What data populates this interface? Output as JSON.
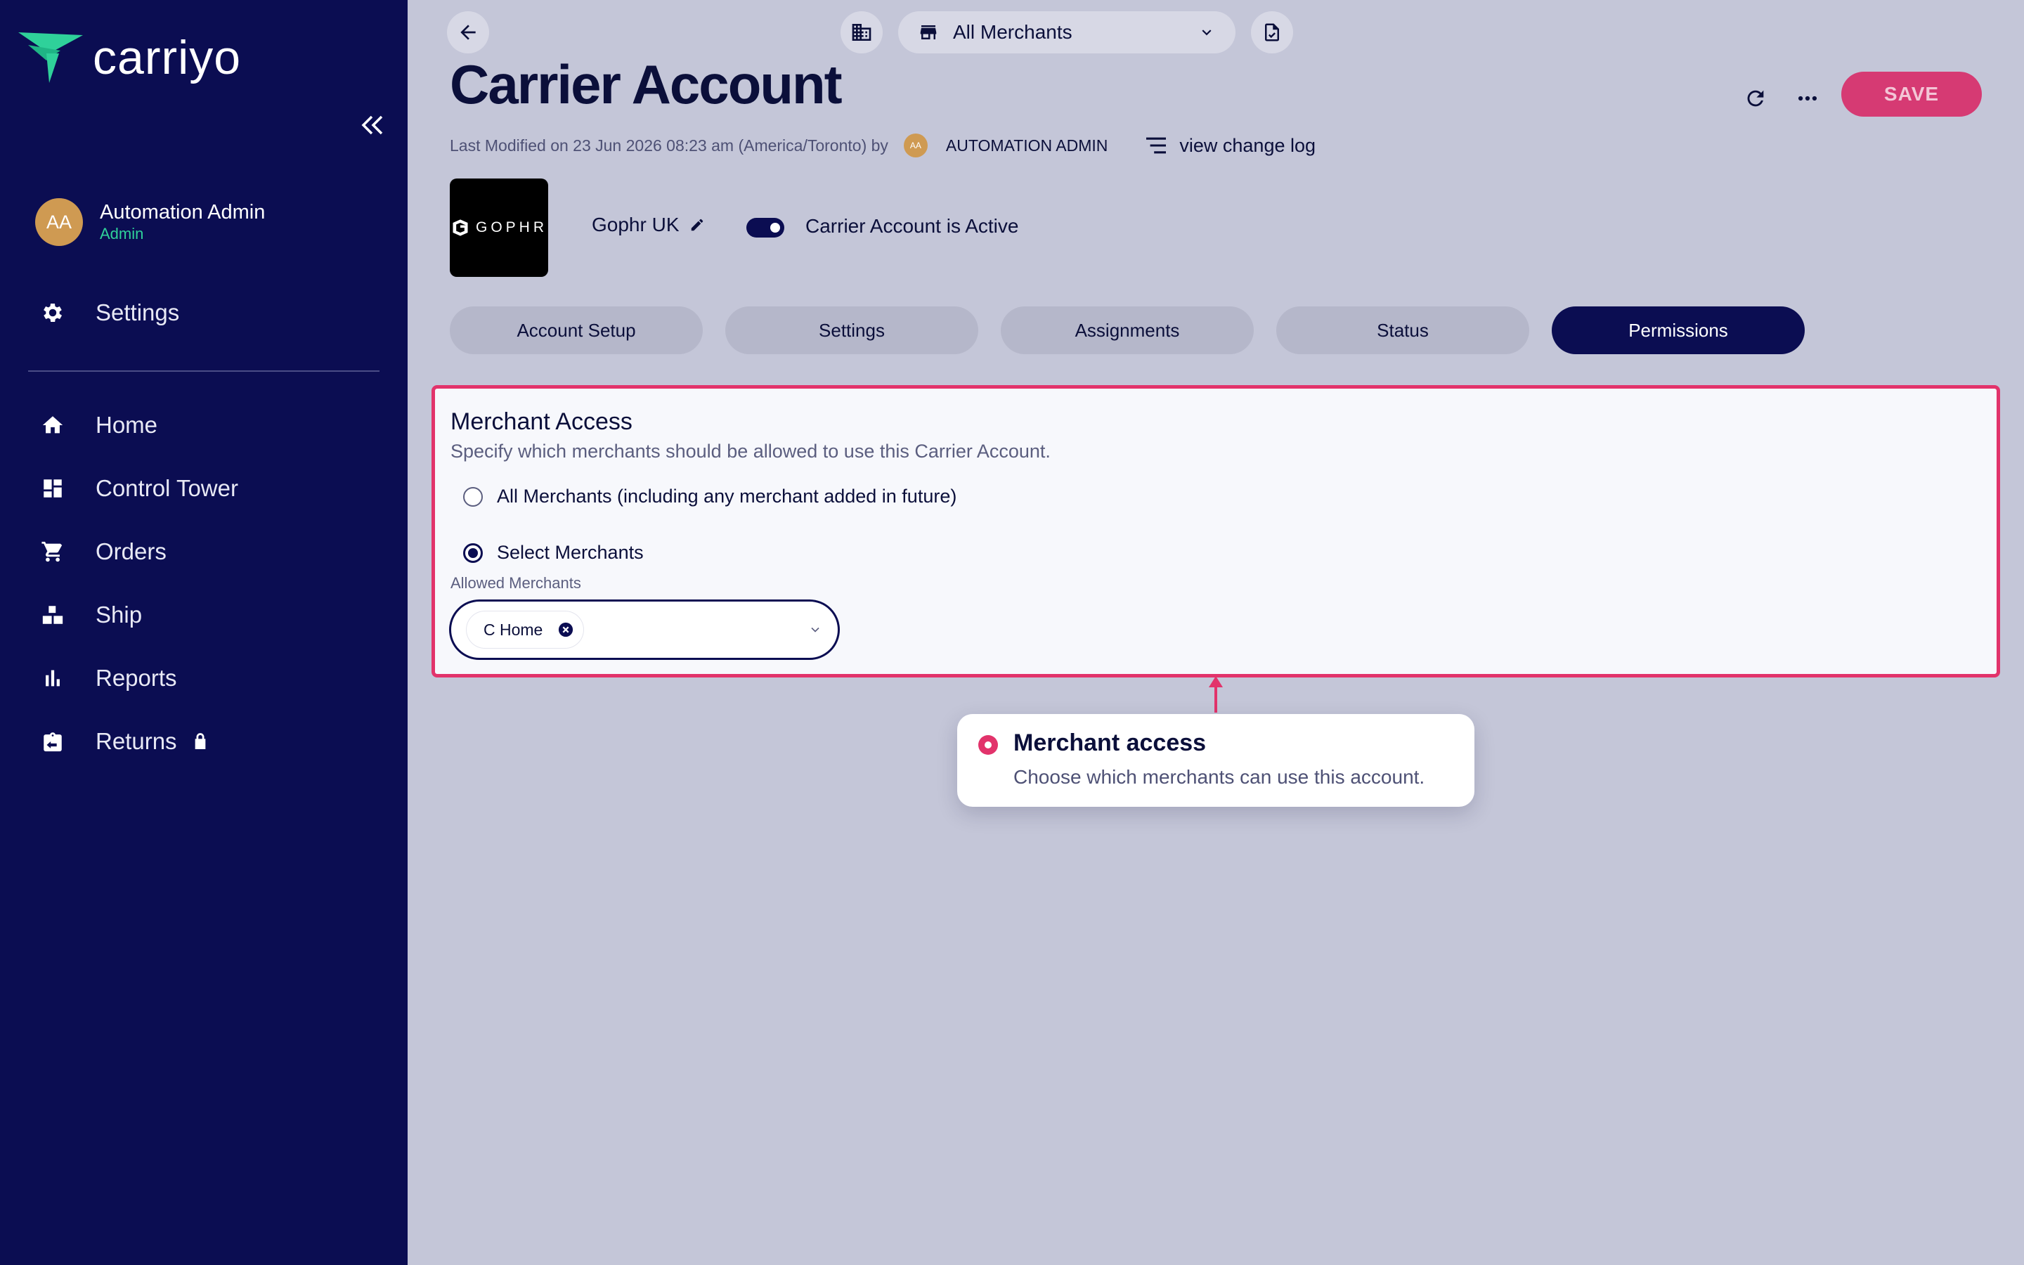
{
  "brand": {
    "name": "carriyo",
    "accent": "#2fd19a",
    "sidebar_bg": "#0b0d52",
    "highlight": "#e2336b"
  },
  "user": {
    "initials": "AA",
    "name": "Automation Admin",
    "role": "Admin"
  },
  "sidebar": {
    "settings_label": "Settings",
    "items": [
      {
        "label": "Home",
        "icon": "home-icon"
      },
      {
        "label": "Control Tower",
        "icon": "dashboard-icon"
      },
      {
        "label": "Orders",
        "icon": "cart-icon"
      },
      {
        "label": "Ship",
        "icon": "ship-icon"
      },
      {
        "label": "Reports",
        "icon": "bar-chart-icon"
      },
      {
        "label": "Returns",
        "icon": "returns-icon",
        "locked": true
      }
    ]
  },
  "header": {
    "merchant_select": "All Merchants",
    "page_title": "Carrier Account",
    "save_label": "SAVE",
    "meta_text": "Last Modified on 23 Jun 2026 08:23 am (America/Toronto) by",
    "meta_user_initials": "AA",
    "meta_user": "AUTOMATION ADMIN",
    "changelog_label": "view change log"
  },
  "carrier": {
    "logo_text": "GOPHR",
    "name": "Gophr UK",
    "active_label": "Carrier Account is Active",
    "active": true
  },
  "tabs": [
    {
      "label": "Account Setup",
      "active": false
    },
    {
      "label": "Settings",
      "active": false
    },
    {
      "label": "Assignments",
      "active": false
    },
    {
      "label": "Status",
      "active": false
    },
    {
      "label": "Permissions",
      "active": true
    }
  ],
  "panel": {
    "title": "Merchant Access",
    "subtitle": "Specify which merchants should be allowed to use this Carrier Account.",
    "option_all": "All Merchants (including any merchant added in future)",
    "option_select": "Select Merchants",
    "selected_option": "select",
    "field_label": "Allowed Merchants",
    "chips": [
      "C Home"
    ]
  },
  "callout": {
    "title": "Merchant access",
    "text": "Choose which merchants can use this account."
  }
}
